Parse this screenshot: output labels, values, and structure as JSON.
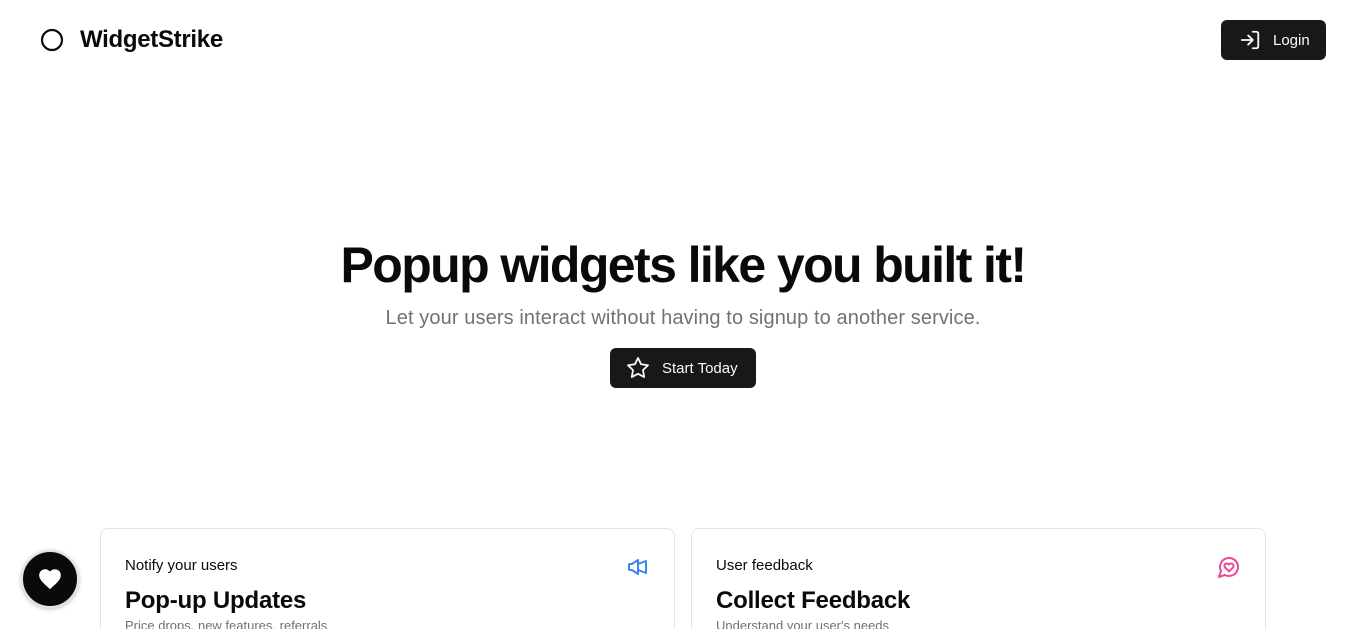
{
  "header": {
    "brand_name": "WidgetStrike",
    "brand_icon": "circle-icon",
    "login_label": "Login",
    "login_icon": "log-in-icon"
  },
  "hero": {
    "title": "Popup widgets like you built it!",
    "subtitle": "Let your users interact without having to signup to another service.",
    "cta_label": "Start Today",
    "cta_icon": "star-icon"
  },
  "features": [
    {
      "label": "Notify your users",
      "title": "Pop-up Updates",
      "description": "Price drops, new features, referrals",
      "icon": "megaphone-icon",
      "icon_color": "#3b82f6"
    },
    {
      "label": "User feedback",
      "title": "Collect Feedback",
      "description": "Understand your user's needs",
      "icon": "message-heart-icon",
      "icon_color": "#ec4899"
    }
  ],
  "widget_launcher": {
    "icon": "heart-icon"
  },
  "colors": {
    "primary_button": "#18181b",
    "muted_text": "#71717a",
    "border": "#e4e4e7"
  }
}
